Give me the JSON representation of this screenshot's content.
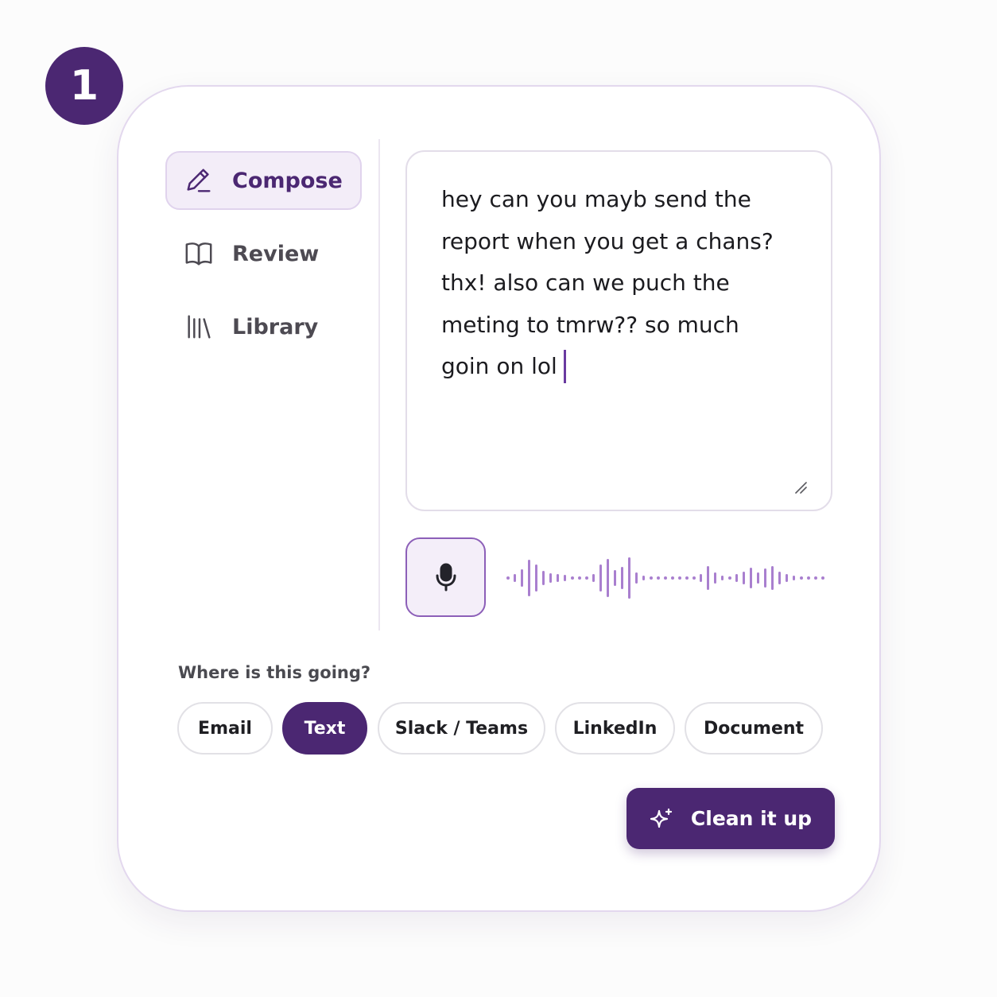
{
  "step": {
    "number": "1"
  },
  "sidebar": {
    "items": [
      {
        "label": "Compose",
        "icon": "pencil-icon",
        "active": true
      },
      {
        "label": "Review",
        "icon": "book-icon",
        "active": false
      },
      {
        "label": "Library",
        "icon": "library-icon",
        "active": false
      }
    ]
  },
  "editor": {
    "lines": [
      "hey can you mayb send the",
      "report when you get a chans?",
      "thx! also can we puch the",
      "meting to tmrw?? so much",
      "goin on lol"
    ]
  },
  "mic": {
    "icon": "microphone-icon"
  },
  "destination": {
    "label": "Where is this going?",
    "options": [
      "Email",
      "Text",
      "Slack / Teams",
      "LinkedIn",
      "Document"
    ],
    "selected": "Text"
  },
  "action": {
    "label": "Clean it up",
    "icon": "sparkle-icon"
  },
  "colors": {
    "accent": "#4b2772",
    "accent_soft": "#f3edf8",
    "waveform": "#a97fcf",
    "border": "#e3d8ee"
  }
}
